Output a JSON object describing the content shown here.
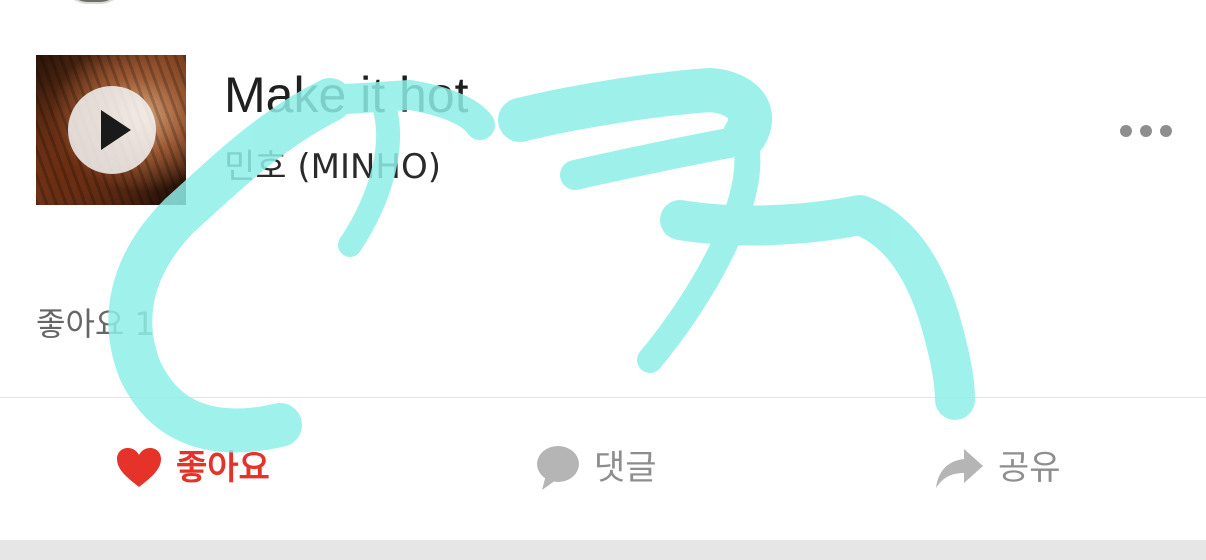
{
  "colors": {
    "accent_red": "#e5332a",
    "icon_gray": "#b5b5b5",
    "text_gray": "#8e8e8e",
    "marker_cyan": "#8eefe8"
  },
  "post": {
    "song": {
      "title": "Make it hot",
      "artist": "민호 (MINHO)",
      "icon": "play-icon"
    },
    "more_icon": "more-options-icon",
    "likes_text": "좋아요 1"
  },
  "actions": [
    {
      "label": "좋아요",
      "icon": "heart-icon",
      "active": true
    },
    {
      "label": "댓글",
      "icon": "comment-icon",
      "active": false
    },
    {
      "label": "공유",
      "icon": "share-icon",
      "active": false
    }
  ],
  "handwritten_overlay": {
    "text": "ㄷㅋ",
    "color": "#8eefe8"
  }
}
